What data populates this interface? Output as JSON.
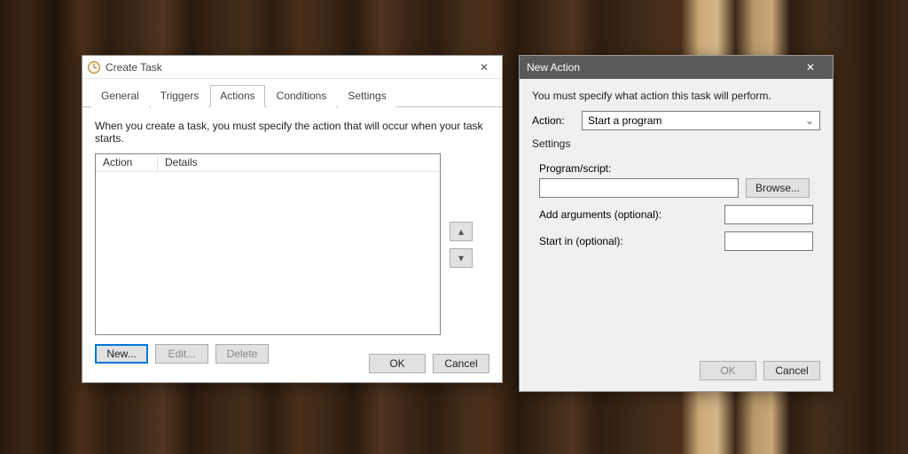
{
  "createTask": {
    "title": "Create Task",
    "tabs": [
      "General",
      "Triggers",
      "Actions",
      "Conditions",
      "Settings"
    ],
    "activeTabIndex": 2,
    "description": "When you create a task, you must specify the action that will occur when your task starts.",
    "columns": {
      "action": "Action",
      "details": "Details"
    },
    "upGlyph": "▴",
    "downGlyph": "▾",
    "buttons": {
      "new": "New...",
      "edit": "Edit...",
      "delete": "Delete"
    },
    "footer": {
      "ok": "OK",
      "cancel": "Cancel"
    },
    "closeGlyph": "✕"
  },
  "newAction": {
    "title": "New Action",
    "description": "You must specify what action this task will perform.",
    "actionLabel": "Action:",
    "actionValue": "Start a program",
    "chevGlyph": "⌄",
    "settingsLabel": "Settings",
    "programLabel": "Program/script:",
    "browse": "Browse...",
    "argumentsLabel": "Add arguments (optional):",
    "startInLabel": "Start in (optional):",
    "footer": {
      "ok": "OK",
      "cancel": "Cancel"
    },
    "closeGlyph": "✕"
  }
}
